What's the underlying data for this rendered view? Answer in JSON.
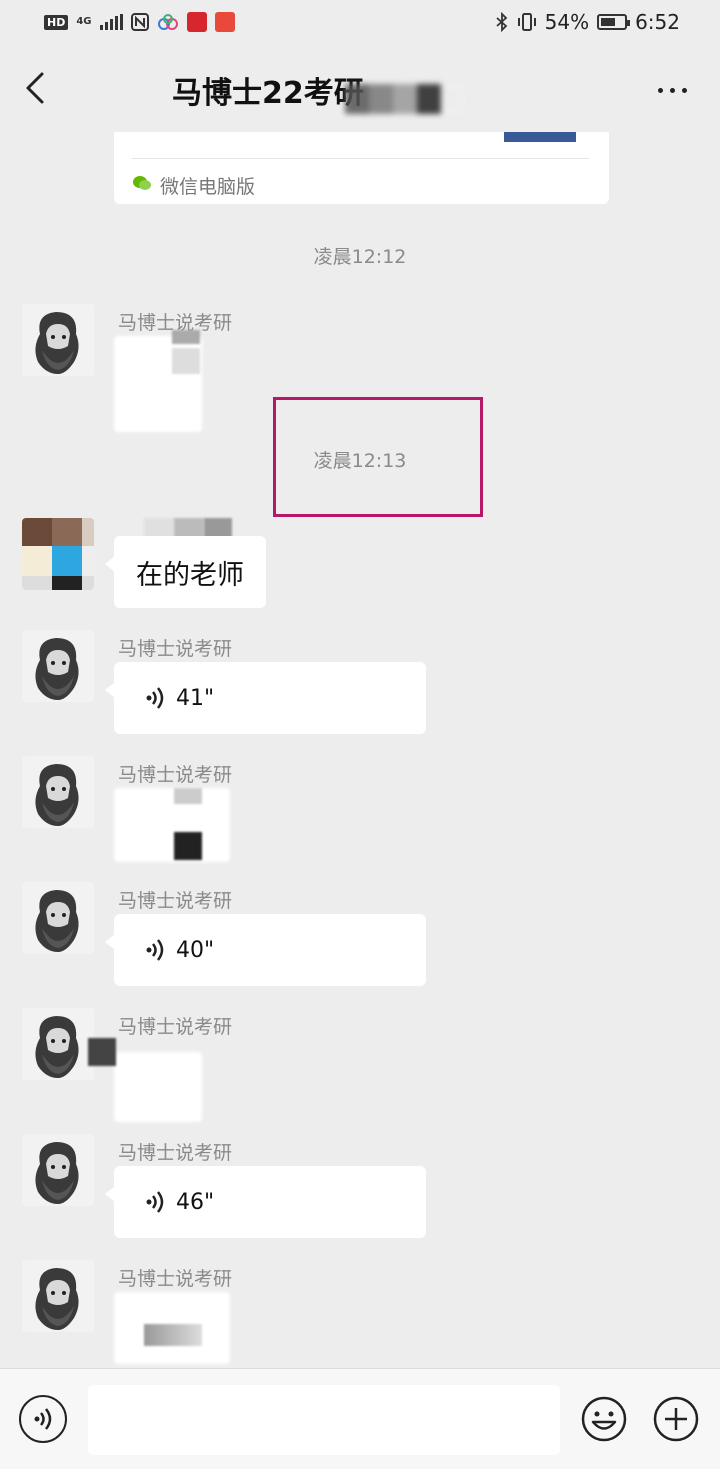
{
  "status_bar": {
    "hd": "HD",
    "network": "4G",
    "battery": "54%",
    "battery_level": 0.54,
    "time": "6:52"
  },
  "header": {
    "title": "马博士22考研",
    "back_icon": "chevron-left-icon",
    "more_icon": "more-horizontal-icon"
  },
  "card": {
    "source": "微信电脑版",
    "accent_color": "#3a5a97"
  },
  "times": [
    "凌晨12:12",
    "凌晨12:13"
  ],
  "sender_name": "马博士说考研",
  "messages": {
    "reply_text": "在的老师",
    "voice_1": "41\"",
    "voice_2": "40\"",
    "voice_3": "46\""
  },
  "colors": {
    "background": "#ededed",
    "bubble": "#ffffff",
    "highlight": "#b5176a"
  },
  "input_bar": {
    "placeholder": "",
    "voice_icon": "voice-icon",
    "emoji_icon": "emoji-icon",
    "plus_icon": "plus-circle-icon"
  }
}
